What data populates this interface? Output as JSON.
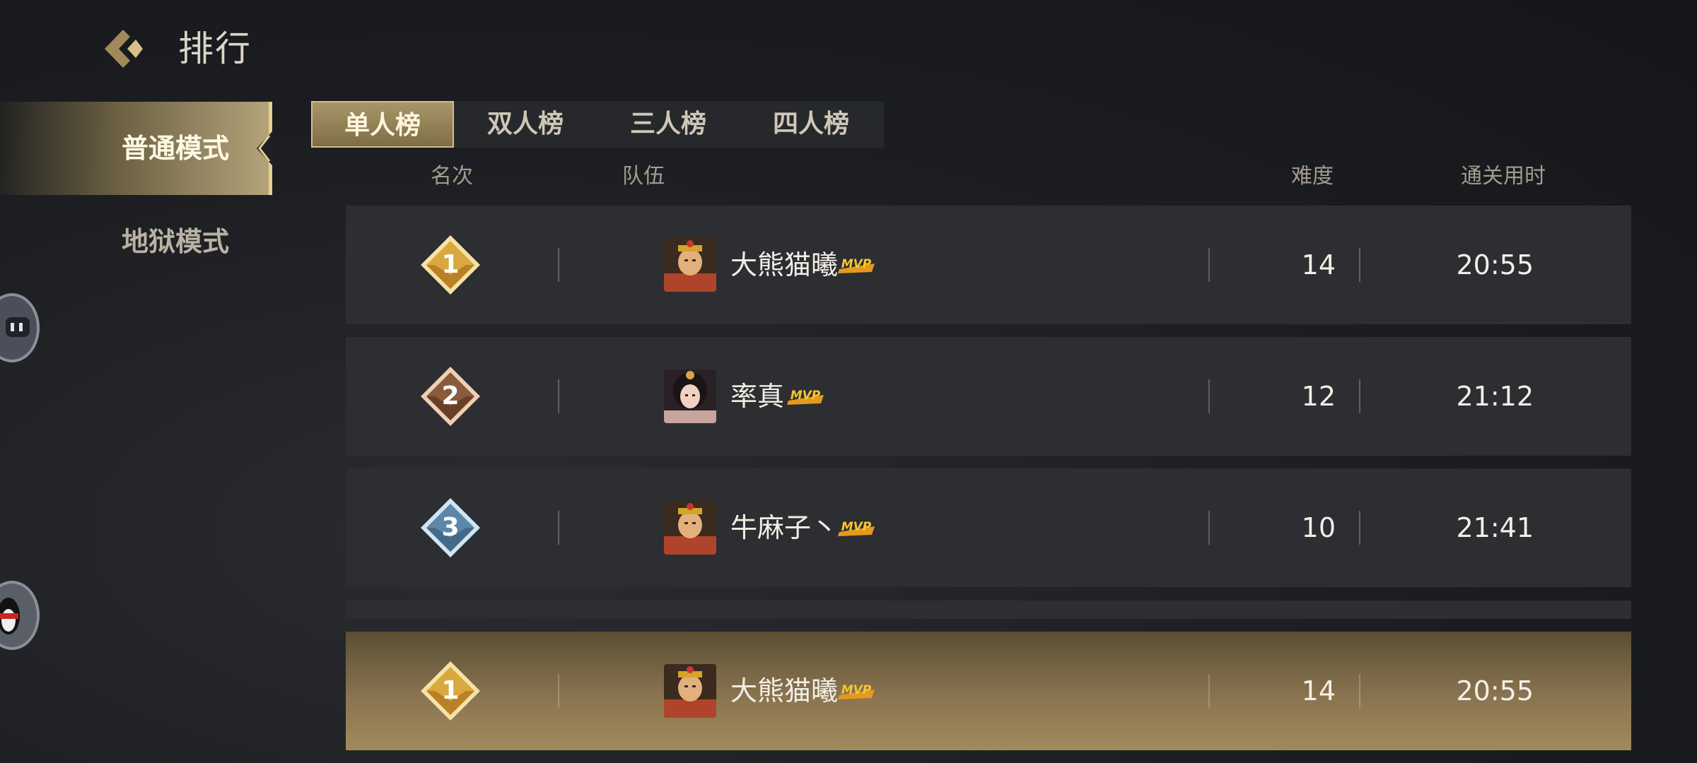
{
  "header": {
    "title": "排行"
  },
  "sidebar": {
    "items": [
      {
        "label": "普通模式",
        "active": true
      },
      {
        "label": "地狱模式",
        "active": false
      }
    ]
  },
  "tabs": [
    {
      "label": "单人榜",
      "active": true
    },
    {
      "label": "双人榜",
      "active": false
    },
    {
      "label": "三人榜",
      "active": false
    },
    {
      "label": "四人榜",
      "active": false
    }
  ],
  "columns": {
    "rank": "名次",
    "team": "队伍",
    "difficulty": "难度",
    "time": "通关用时"
  },
  "rows": [
    {
      "rank": "1",
      "name": "大熊猫曦",
      "mvp": "MVP",
      "difficulty": "14",
      "time": "20:55",
      "badge_color": "#d9a93f",
      "avatar": "monkey-king"
    },
    {
      "rank": "2",
      "name": "率真",
      "mvp": "MVP",
      "difficulty": "12",
      "time": "21:12",
      "badge_color": "#8a5a3c",
      "avatar": "female-hero"
    },
    {
      "rank": "3",
      "name": "牛麻子丶",
      "mvp": "MVP",
      "difficulty": "10",
      "time": "21:41",
      "badge_color": "#5d87a8",
      "avatar": "monkey-king"
    }
  ],
  "my_row": {
    "rank": "1",
    "name": "大熊猫曦",
    "mvp": "MVP",
    "difficulty": "14",
    "time": "20:55",
    "badge_color": "#d9a93f",
    "avatar": "monkey-king"
  },
  "colors": {
    "accent_gold": "#d3bd85",
    "mvp_yellow": "#f0b323",
    "row_bg": "#2c2e32"
  }
}
